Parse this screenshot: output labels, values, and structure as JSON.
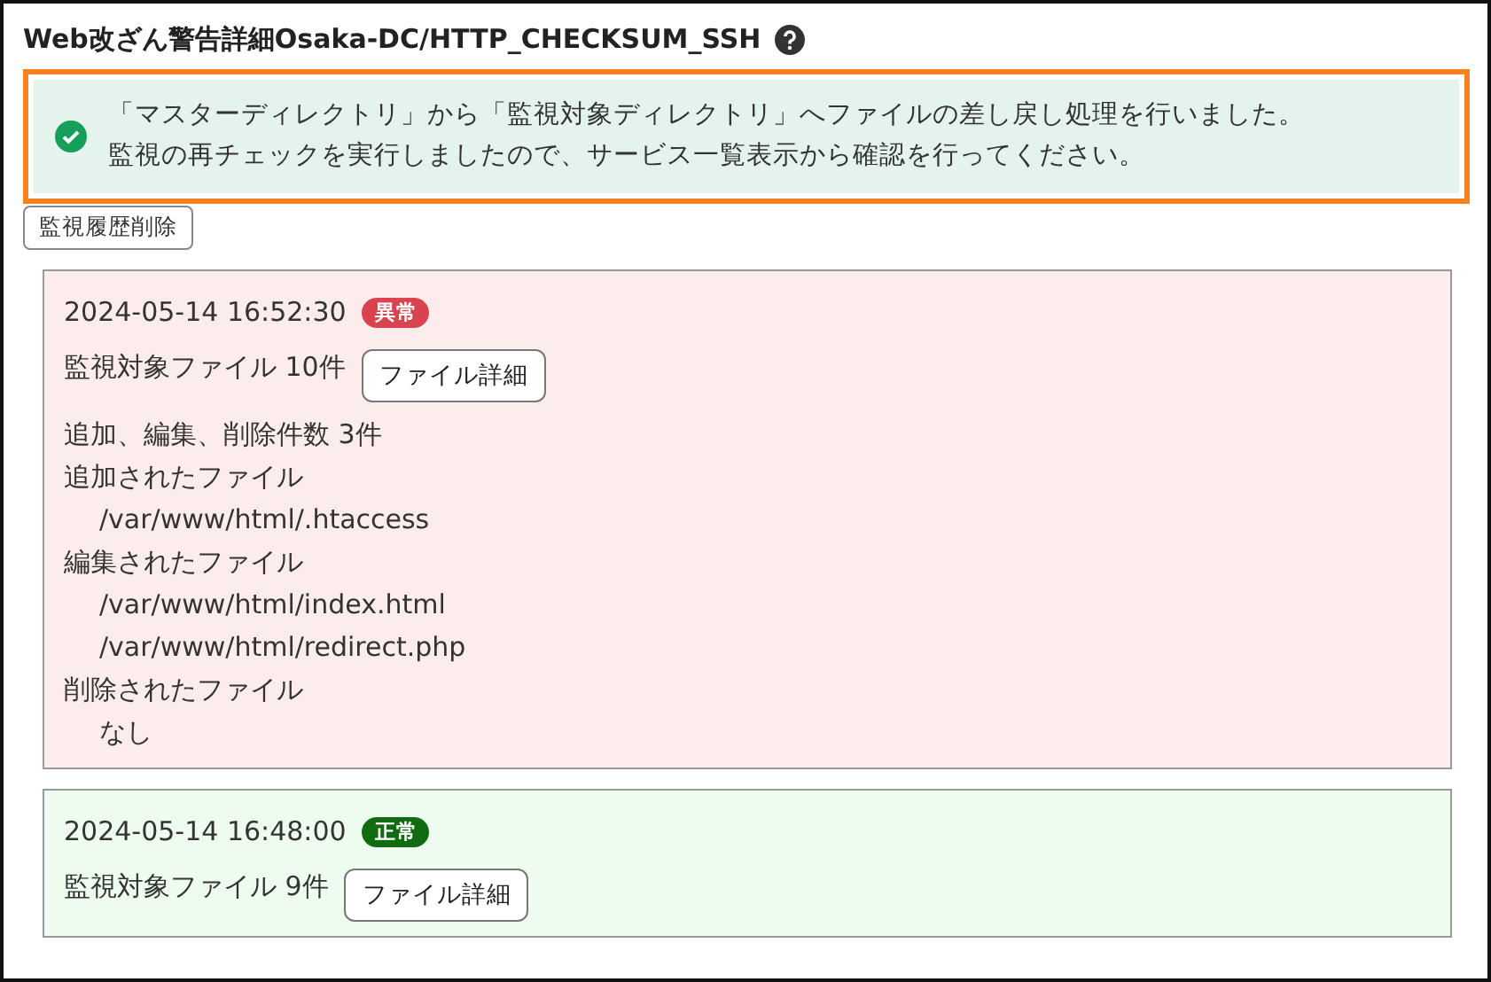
{
  "title": "Web改ざん警告詳細Osaka-DC/HTTP_CHECKSUM_SSH",
  "alert": {
    "lines": [
      "「マスターディレクトリ」から「監視対象ディレクトリ」へファイルの差し戻し処理を行いました。",
      "監視の再チェックを実行しましたので、サービス一覧表示から確認を行ってください。"
    ]
  },
  "delete_button": "監視履歴削除",
  "entries": [
    {
      "timestamp": "2024-05-14 16:52:30",
      "status": {
        "label": "異常",
        "kind": "error"
      },
      "file_count": "監視対象ファイル 10件",
      "button": "ファイル詳細",
      "summary": "追加、編集、削除件数 3件",
      "sections": [
        {
          "title": "追加されたファイル",
          "items": [
            "/var/www/html/.htaccess"
          ]
        },
        {
          "title": "編集されたファイル",
          "items": [
            "/var/www/html/index.html",
            "/var/www/html/redirect.php"
          ]
        },
        {
          "title": "削除されたファイル",
          "items": [
            "なし"
          ]
        }
      ]
    },
    {
      "timestamp": "2024-05-14 16:48:00",
      "status": {
        "label": "正常",
        "kind": "ok"
      },
      "file_count": "監視対象ファイル 9件",
      "button": "ファイル詳細"
    }
  ]
}
